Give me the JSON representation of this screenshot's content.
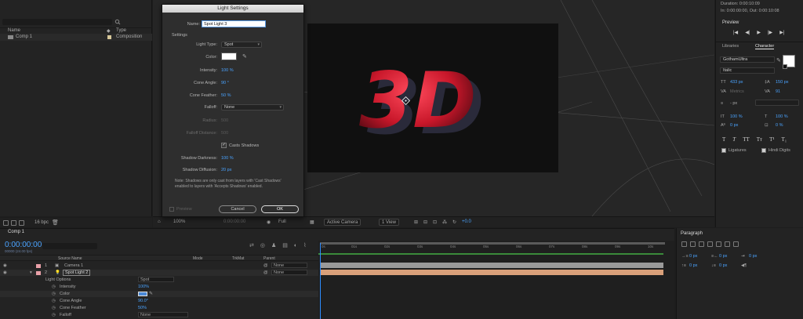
{
  "project": {
    "search_placeholder": "",
    "columns": {
      "name": "Name",
      "type": "Type"
    },
    "item": {
      "name": "Comp 1",
      "type": "Composition"
    },
    "bpc": "16 bpc"
  },
  "dialog": {
    "title": "Light Settings",
    "name_label": "Name:",
    "name_value": "Spot Light 3",
    "settings_label": "Settings",
    "light_type_label": "Light Type:",
    "light_type_value": "Spot",
    "color_label": "Color:",
    "intensity_label": "Intensity:",
    "intensity_value": "100 %",
    "cone_angle_label": "Cone Angle:",
    "cone_angle_value": "90 °",
    "cone_feather_label": "Cone Feather:",
    "cone_feather_value": "50 %",
    "falloff_label": "Falloff:",
    "falloff_value": "None",
    "radius_label": "Radius:",
    "radius_value": "500",
    "falloff_distance_label": "Falloff Distance:",
    "falloff_distance_value": "500",
    "casts_shadows_label": "Casts Shadows",
    "shadow_darkness_label": "Shadow Darkness:",
    "shadow_darkness_value": "100 %",
    "shadow_diffusion_label": "Shadow Diffusion:",
    "shadow_diffusion_value": "20 px",
    "note": "Note: Shadows are only cast from layers with 'Cast Shadows' enabled to layers with 'Accepts Shadows' enabled.",
    "preview_label": "Preview",
    "cancel_label": "Cancel",
    "ok_label": "OK"
  },
  "viewer": {
    "headline": "3D",
    "zoom": "100%",
    "timecode": "0:00:00:00",
    "resolution": "Full",
    "camera": "Active Camera",
    "view": "1 View",
    "exposure": "+0.0"
  },
  "right_panel": {
    "duration": "Duration: 0:00:10:09",
    "in_out": "In: 0:00:00:00, Out: 0:00:10:08",
    "preview_title": "Preview",
    "tabs": {
      "libraries": "Libraries",
      "character": "Character"
    },
    "font": "GothamUltra",
    "style": "Italic",
    "font_size": "433 px",
    "leading": "150 px",
    "kerning": "Metrics",
    "tracking": "91",
    "stroke": "- px",
    "vscale": "100 %",
    "hscale": "100 %",
    "baseline": "0 px",
    "tsume": "0 %",
    "type_styles": [
      "T",
      "T",
      "TT",
      "Tт",
      "T¹",
      "T₁"
    ],
    "ligatures": "Ligatures",
    "hindi_digits": "Hindi Digits"
  },
  "timeline": {
    "tab": "Comp 1",
    "timecode": "0:00:00:00",
    "fps": "00000 (24.00 fps)",
    "columns": {
      "source_name": "Source Name",
      "mode": "Mode",
      "trkmat": "TrkMat",
      "parent": "Parent"
    },
    "layers": [
      {
        "num": "1",
        "name": "Camera 1",
        "parent": "None"
      },
      {
        "num": "2",
        "name": "Spot Light 2",
        "parent": "None"
      }
    ],
    "light_options": {
      "label": "Light Options",
      "value": "Spot"
    },
    "props": [
      {
        "name": "Intensity",
        "value": "100%"
      },
      {
        "name": "Color",
        "value": ""
      },
      {
        "name": "Cone Angle",
        "value": "90.0°"
      },
      {
        "name": "Cone Feather",
        "value": "50%"
      },
      {
        "name": "Falloff",
        "value": "None"
      }
    ],
    "ruler": [
      "0s",
      "01s",
      "02s",
      "03s",
      "04s",
      "05s",
      "06s",
      "07s",
      "08s",
      "09s",
      "10s"
    ]
  },
  "paragraph": {
    "title": "Paragraph",
    "fields": [
      "0 px",
      "0 px",
      "0 px",
      "0 px",
      "0 px"
    ]
  },
  "colors": {
    "accent": "#4aa3ff",
    "camera_swatch": "#e8a0a8",
    "light_swatch": "#e8a0a8",
    "layer_bar_camera": "#9a9a9a",
    "layer_bar_light": "#d9a07a",
    "text_3d": "#e8283c"
  }
}
